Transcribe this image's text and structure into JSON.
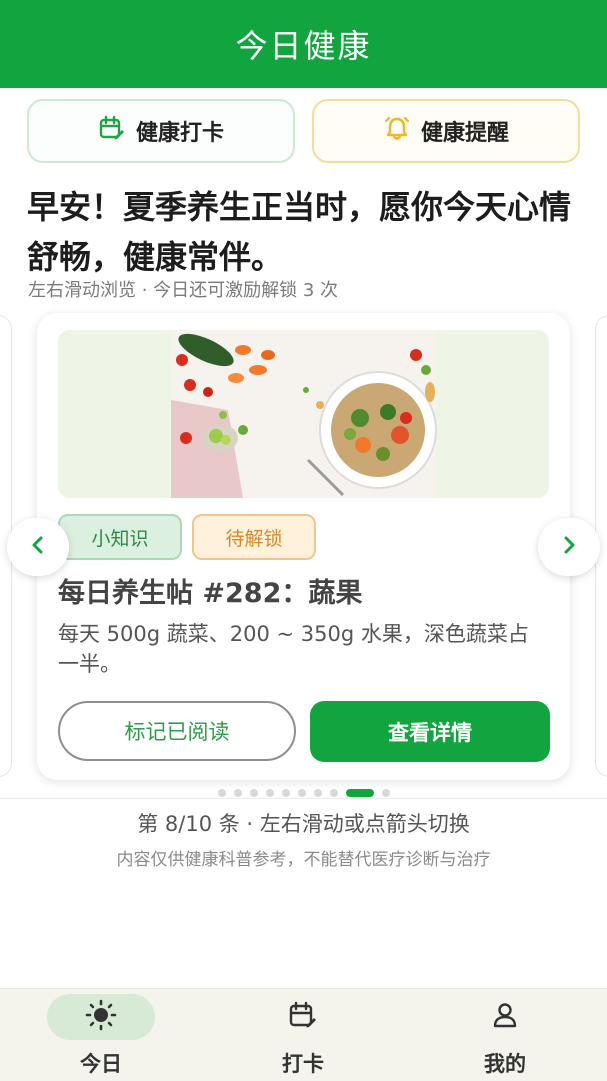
{
  "app": {
    "title": "今日健康"
  },
  "quick_actions": {
    "checkin_label": "健康打卡",
    "remind_label": "健康提醒"
  },
  "greeting": {
    "text": "早安！夏季养生正当时，愿你今天心情舒畅，健康常伴。",
    "hint": "左右滑动浏览 · 今日还可激励解锁 3 次"
  },
  "card": {
    "tag_tip": "小知识",
    "tag_lock": "待解锁",
    "title": "每日养生帖 #282：蔬果",
    "body": "每天 500g 蔬菜、200 ~ 350g 水果，深色蔬菜占一半。",
    "read_label": "标记已阅读",
    "detail_label": "查看详情",
    "image_icon": "vegetable-bowl-photo"
  },
  "pager": {
    "total": 10,
    "current": 8,
    "counter_text": "第 8/10 条 · 左右滑动或点箭头切换",
    "disclaimer": "内容仅供健康科普参考，不能替代医疗诊断与治疗"
  },
  "nav": {
    "today": "今日",
    "checkin": "打卡",
    "mine": "我的"
  },
  "colors": {
    "brand": "#12a53f",
    "remind": "#f0b623",
    "lock_tag": "#d38a2b"
  }
}
